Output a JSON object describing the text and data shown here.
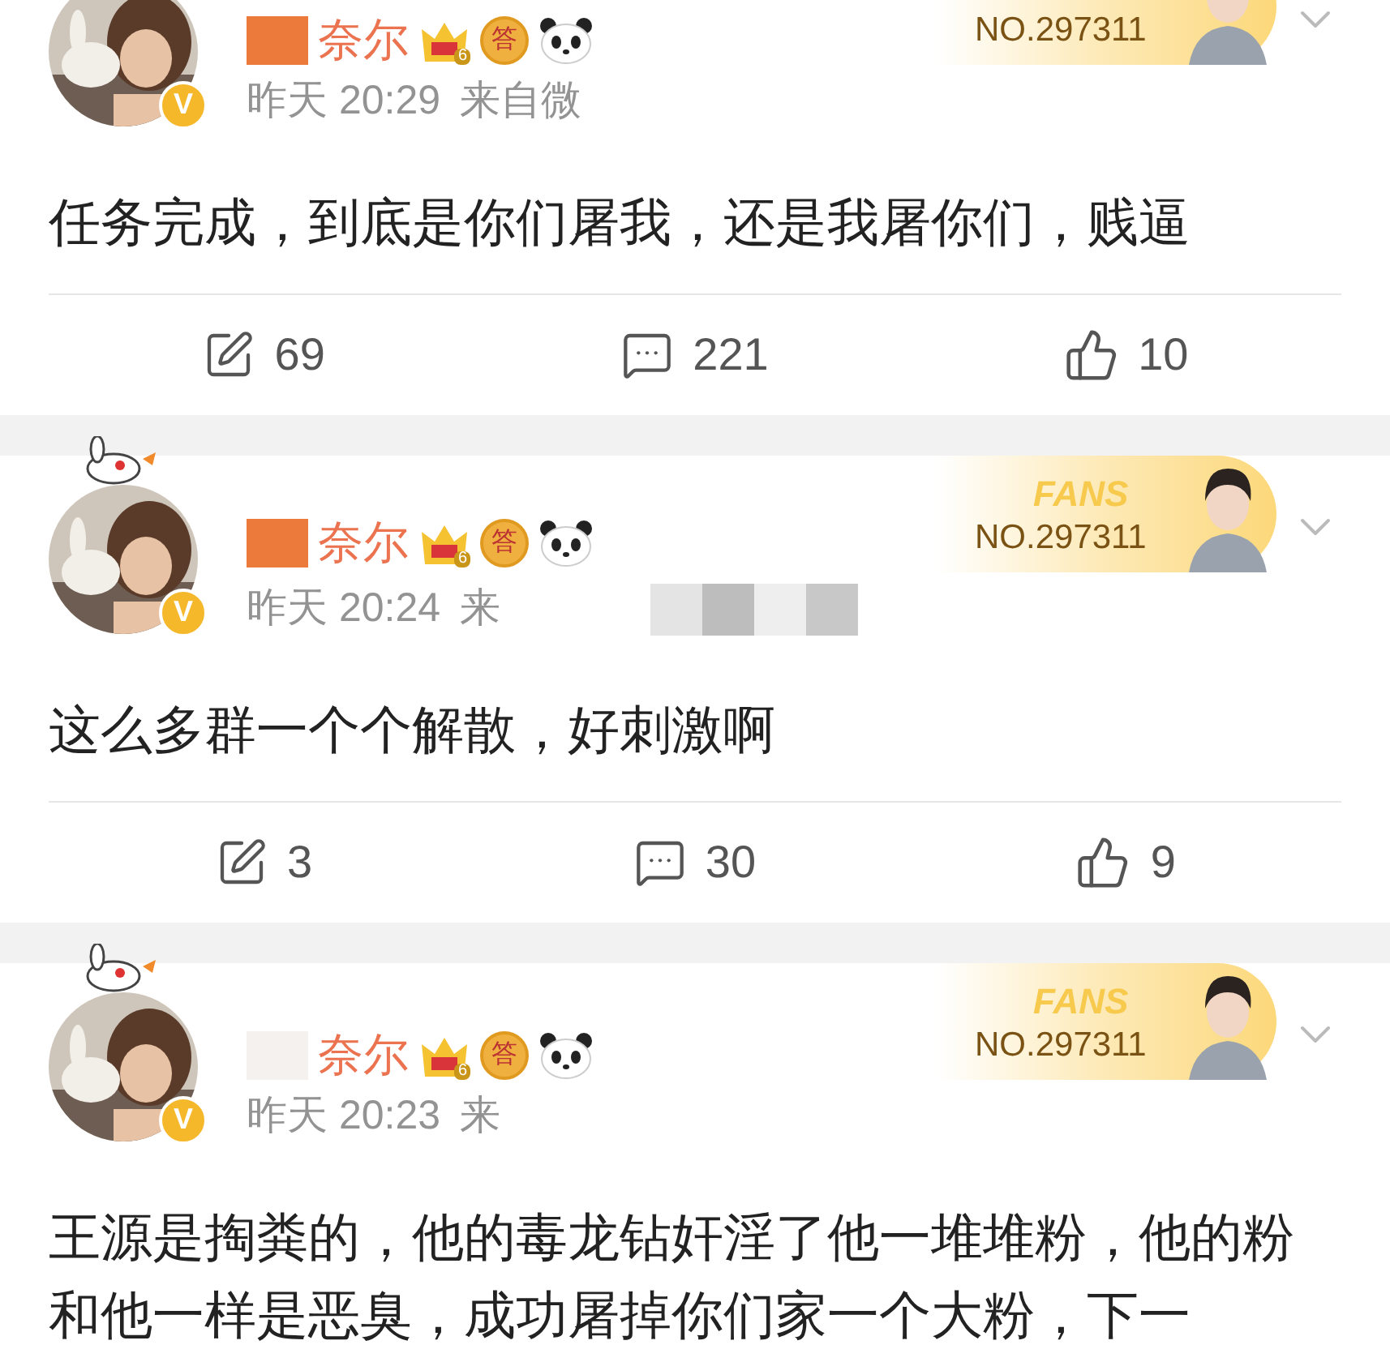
{
  "posts": [
    {
      "author": {
        "name": "奈尔",
        "verified": "V",
        "name_redacted": true,
        "name_redaction_strong": true,
        "badges": [
          {
            "kind": "crown",
            "label": "6"
          },
          {
            "kind": "medal",
            "label": "答"
          },
          {
            "kind": "panda"
          }
        ]
      },
      "fan_badge": {
        "number": "NO.297311"
      },
      "time": "昨天 20:29",
      "source": "来自微",
      "source_redaction": false,
      "text": "任务完成，到底是你们屠我，还是我屠你们，贱逼",
      "actions": {
        "reposts": "69",
        "comments": "221",
        "likes": "10"
      }
    },
    {
      "author": {
        "name": "奈尔",
        "verified": "V",
        "name_redacted": true,
        "name_redaction_strong": true,
        "badges": [
          {
            "kind": "crown",
            "label": "6"
          },
          {
            "kind": "medal",
            "label": "答"
          },
          {
            "kind": "panda"
          }
        ]
      },
      "fan_badge": {
        "label": "FANS",
        "number": "NO.297311"
      },
      "time": "昨天 20:24",
      "source": "来",
      "source_redaction": true,
      "text": "这么多群一个个解散，好刺激啊",
      "actions": {
        "reposts": "3",
        "comments": "30",
        "likes": "9"
      }
    },
    {
      "author": {
        "name": "奈尔",
        "verified": "V",
        "name_redacted": true,
        "name_redaction_strong": false,
        "badges": [
          {
            "kind": "crown",
            "label": "6"
          },
          {
            "kind": "medal",
            "label": "答"
          },
          {
            "kind": "panda"
          }
        ]
      },
      "fan_badge": {
        "label": "FANS",
        "number": "NO.297311"
      },
      "time": "昨天 20:23",
      "source": "来",
      "source_redaction": false,
      "text": "王源是掏粪的，他的毒龙钻奸淫了他一堆堆粉，他的粉和他一样是恶臭，成功屠掉你们家一个大粉，下一"
    }
  ]
}
